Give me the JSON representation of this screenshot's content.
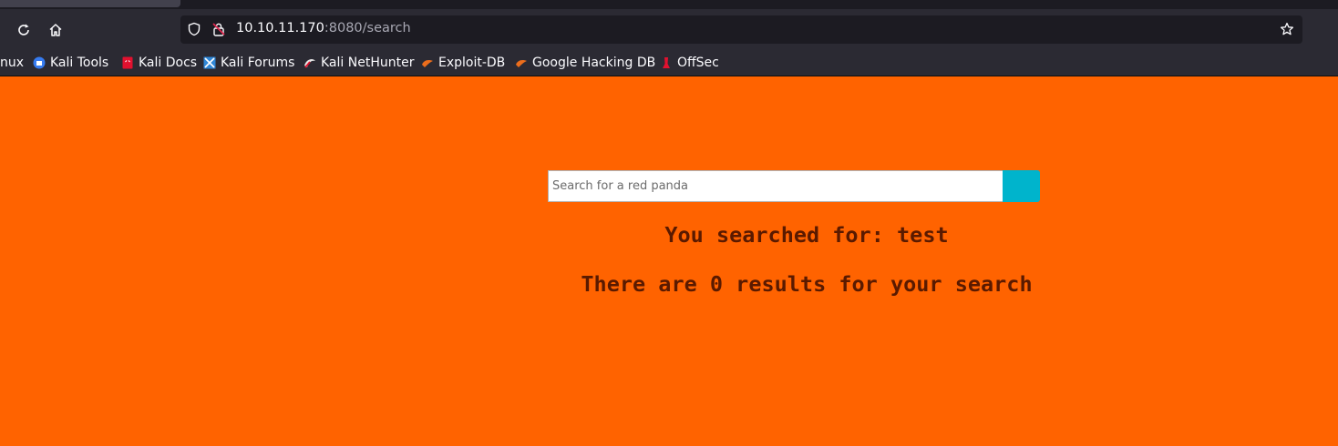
{
  "browser": {
    "url_host": "10.10.11.170",
    "url_path": ":8080/search"
  },
  "bookmarks": [
    {
      "label": "nux",
      "icon": "kali-linux-icon"
    },
    {
      "label": "Kali Tools",
      "icon": "kali-tools-icon"
    },
    {
      "label": "Kali Docs",
      "icon": "kali-docs-icon"
    },
    {
      "label": "Kali Forums",
      "icon": "kali-forums-icon"
    },
    {
      "label": "Kali NetHunter",
      "icon": "kali-nethunter-icon"
    },
    {
      "label": "Exploit-DB",
      "icon": "exploit-db-icon"
    },
    {
      "label": "Google Hacking DB",
      "icon": "ghdb-icon"
    },
    {
      "label": "OffSec",
      "icon": "offsec-icon"
    }
  ],
  "page": {
    "search_placeholder": "Search for a red panda",
    "searched_for": "You searched for: test",
    "results_message": "There are 0 results for your search"
  },
  "colors": {
    "page_background": "#ff6300",
    "search_button": "#00b4cc",
    "message_text": "#5a1a00"
  }
}
